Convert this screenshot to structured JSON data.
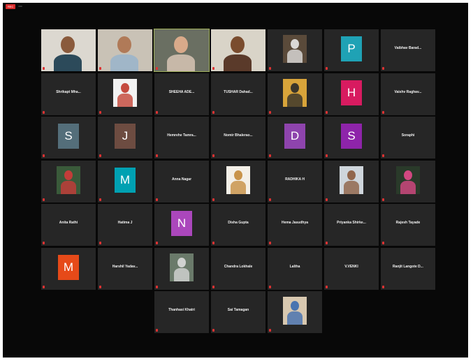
{
  "topbar": {
    "left_text": "",
    "rec_label": "REC",
    "view_label": ""
  },
  "tiles": [
    {
      "type": "video",
      "label": "",
      "bg": "#dcd8d0",
      "skin": "#8a5a3c",
      "shirt": "#2c4a5a"
    },
    {
      "type": "video",
      "label": "",
      "bg": "#c9c2b6",
      "skin": "#b07a58",
      "shirt": "#a0b6c8"
    },
    {
      "type": "video",
      "label": "",
      "bg": "#6a6f62",
      "skin": "#d9aa8a",
      "shirt": "#c7b8a8",
      "active": true
    },
    {
      "type": "video",
      "label": "",
      "bg": "#d9d4c8",
      "skin": "#7a4c2e",
      "shirt": "#5a3a2a"
    },
    {
      "type": "photo",
      "label": "",
      "photo_bg": "#5a4a3a",
      "fg": "#e8e8e8"
    },
    {
      "type": "avatar",
      "letter": "P",
      "color": "#1fa2b5",
      "label": ""
    },
    {
      "type": "name",
      "name": "Vaibhav Barad...",
      "label": ""
    },
    {
      "type": "name",
      "name": "Shrikapt Mha...",
      "label": ""
    },
    {
      "type": "photo",
      "label": "",
      "photo_bg": "#f2f2f2",
      "fg": "#c0392b"
    },
    {
      "type": "name",
      "name": "SHEEHA ADE...",
      "label": ""
    },
    {
      "type": "name",
      "name": "TUSHAR Dahad...",
      "label": ""
    },
    {
      "type": "photo",
      "label": "",
      "photo_bg": "#d8a43a",
      "fg": "#2a2a2a"
    },
    {
      "type": "avatar",
      "letter": "H",
      "color": "#d81b60",
      "label": ""
    },
    {
      "type": "name",
      "name": "Vaishv Raghav...",
      "label": ""
    },
    {
      "type": "avatar",
      "letter": "S",
      "color": "#546e7a",
      "label": ""
    },
    {
      "type": "avatar",
      "letter": "J",
      "color": "#6d4c41",
      "label": ""
    },
    {
      "type": "name",
      "name": "Hemrehe Tamra...",
      "label": ""
    },
    {
      "type": "name",
      "name": "Nomir Bhalerao...",
      "label": ""
    },
    {
      "type": "avatar",
      "letter": "D",
      "color": "#8e44ad",
      "label": ""
    },
    {
      "type": "avatar",
      "letter": "S",
      "color": "#8e24aa",
      "label": ""
    },
    {
      "type": "name",
      "name": "Soraphi",
      "label": ""
    },
    {
      "type": "photo",
      "label": "",
      "photo_bg": "#3a5a3a",
      "fg": "#d23a3a"
    },
    {
      "type": "avatar",
      "letter": "M",
      "color": "#00a1b2",
      "label": ""
    },
    {
      "type": "name",
      "name": "Anna Nagar",
      "label": ""
    },
    {
      "type": "photo",
      "label": "",
      "photo_bg": "#f4f0e8",
      "fg": "#c48a3a"
    },
    {
      "type": "name",
      "name": "RADHIKA H",
      "label": ""
    },
    {
      "type": "photo",
      "label": "",
      "photo_bg": "#cfd6dc",
      "fg": "#8a5a3c"
    },
    {
      "type": "photo",
      "label": "",
      "photo_bg": "#2a3a2a",
      "fg": "#e34a8a"
    },
    {
      "type": "name",
      "name": "Anita Rathi",
      "label": ""
    },
    {
      "type": "name",
      "name": "Hatima J",
      "label": ""
    },
    {
      "type": "avatar",
      "letter": "N",
      "color": "#ab47bc",
      "label": ""
    },
    {
      "type": "name",
      "name": "Disha Gupta",
      "label": ""
    },
    {
      "type": "name",
      "name": "Hema Jasudhya",
      "label": ""
    },
    {
      "type": "name",
      "name": "Priyanka Shirke...",
      "label": ""
    },
    {
      "type": "name",
      "name": "Rajesh Tayade",
      "label": ""
    },
    {
      "type": "avatar",
      "letter": "M",
      "color": "#e64a19",
      "label": ""
    },
    {
      "type": "name",
      "name": "Harshil Yadav...",
      "label": ""
    },
    {
      "type": "photo",
      "label": "",
      "photo_bg": "#6a7a6a",
      "fg": "#dcdcdc"
    },
    {
      "type": "name",
      "name": "Chandra Lokhale",
      "label": ""
    },
    {
      "type": "name",
      "name": "Laltha",
      "label": ""
    },
    {
      "type": "name",
      "name": "V.VENKI",
      "label": ""
    },
    {
      "type": "name",
      "name": "Ranjit Langote D...",
      "label": ""
    },
    {
      "type": "name",
      "name": "Thanhasi Khatri",
      "label": ""
    },
    {
      "type": "name",
      "name": "Sai Tamagan",
      "label": ""
    },
    {
      "type": "photo",
      "label": "",
      "photo_bg": "#d8c8b0",
      "fg": "#3a6ab0"
    }
  ]
}
